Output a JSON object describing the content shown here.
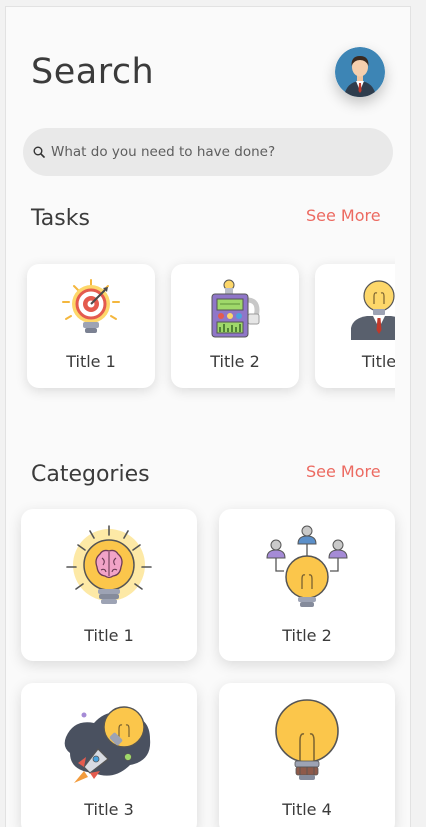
{
  "page": {
    "title": "Search"
  },
  "search": {
    "placeholder": "What do you need to have done?"
  },
  "tasks": {
    "heading": "Tasks",
    "see_more": "See More",
    "items": [
      {
        "label": "Title 1",
        "icon": "target-bulb-icon"
      },
      {
        "label": "Title 2",
        "icon": "machine-icon"
      },
      {
        "label": "Title",
        "icon": "businessman-bulb-icon"
      }
    ]
  },
  "categories": {
    "heading": "Categories",
    "see_more": "See More",
    "items": [
      {
        "label": "Title 1",
        "icon": "brain-bulb-icon"
      },
      {
        "label": "Title 2",
        "icon": "team-bulb-icon"
      },
      {
        "label": "Title 3",
        "icon": "rocket-bulb-icon"
      },
      {
        "label": "Title 4",
        "icon": "bulb-icon"
      }
    ]
  },
  "colors": {
    "accent": "#ec6a61",
    "bulb": "#fbc64b",
    "text": "#3b3b3b"
  }
}
